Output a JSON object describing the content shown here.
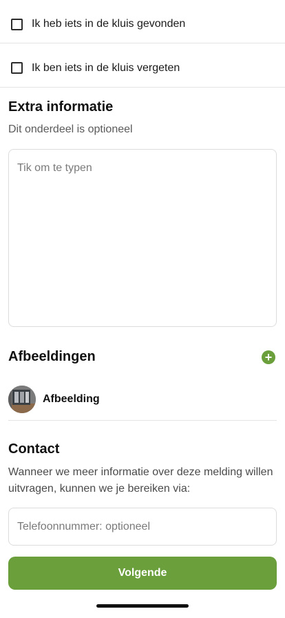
{
  "checkboxes": [
    {
      "label": "Ik heb iets in de kluis gevonden",
      "checked": false
    },
    {
      "label": "Ik ben iets in de kluis vergeten",
      "checked": false
    }
  ],
  "extra_info": {
    "title": "Extra informatie",
    "subtitle": "Dit onderdeel is optioneel",
    "placeholder": "Tik om te typen"
  },
  "images": {
    "title": "Afbeeldingen",
    "add_icon": "plus-circle-icon",
    "items": [
      {
        "label": "Afbeelding"
      }
    ]
  },
  "contact": {
    "title": "Contact",
    "description": "Wanneer we meer informatie over deze melding willen uitvragen, kunnen we je bereiken via:",
    "phone_placeholder": "Telefoonnummer: optioneel"
  },
  "next_button": "Volgende",
  "colors": {
    "accent": "#6a9f3b",
    "border": "#dcdcdc",
    "muted_text": "#5a5a5a"
  }
}
